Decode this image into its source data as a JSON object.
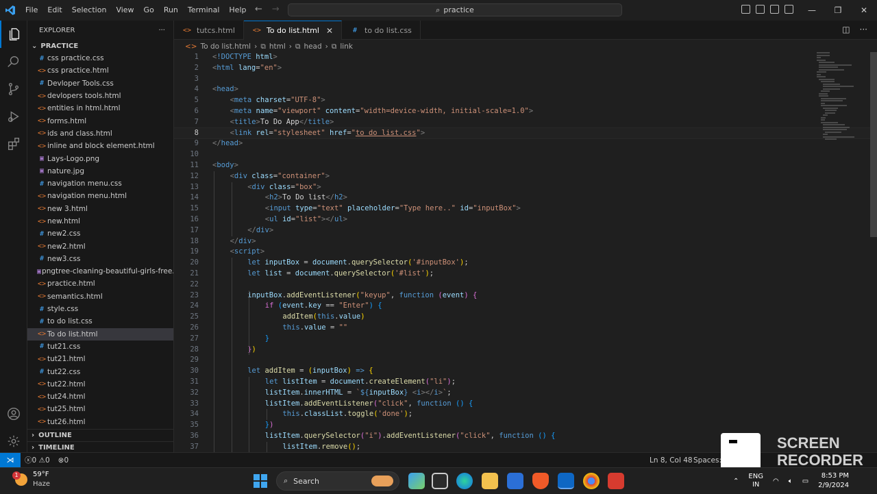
{
  "titlebar": {
    "menu": [
      "File",
      "Edit",
      "Selection",
      "View",
      "Go",
      "Run",
      "Terminal",
      "Help"
    ],
    "search_text": "practice"
  },
  "explorer": {
    "title": "EXPLORER",
    "folder": "PRACTICE",
    "files": [
      {
        "name": "css practice.css",
        "type": "css"
      },
      {
        "name": "css practice.html",
        "type": "html"
      },
      {
        "name": "Devloper Tools.css",
        "type": "css"
      },
      {
        "name": "devlopers tools.html",
        "type": "html"
      },
      {
        "name": "entities in html.html",
        "type": "html"
      },
      {
        "name": "forms.html",
        "type": "html"
      },
      {
        "name": "ids and class.html",
        "type": "html"
      },
      {
        "name": "inline and block element.html",
        "type": "html"
      },
      {
        "name": "Lays-Logo.png",
        "type": "img"
      },
      {
        "name": "nature.jpg",
        "type": "img"
      },
      {
        "name": "navigation menu.css",
        "type": "css"
      },
      {
        "name": "navigation menu.html",
        "type": "html"
      },
      {
        "name": "new 3.html",
        "type": "html"
      },
      {
        "name": "new.html",
        "type": "html"
      },
      {
        "name": "new2.css",
        "type": "css"
      },
      {
        "name": "new2.html",
        "type": "html"
      },
      {
        "name": "new3.css",
        "type": "css"
      },
      {
        "name": "pngtree-cleaning-beautiful-girls-free...",
        "type": "img"
      },
      {
        "name": "practice.html",
        "type": "html"
      },
      {
        "name": "semantics.html",
        "type": "html"
      },
      {
        "name": "style.css",
        "type": "css"
      },
      {
        "name": "to do list.css",
        "type": "css"
      },
      {
        "name": "To do list.html",
        "type": "html",
        "selected": true
      },
      {
        "name": "tut21.css",
        "type": "css"
      },
      {
        "name": "tut21.html",
        "type": "html"
      },
      {
        "name": "tut22.css",
        "type": "css"
      },
      {
        "name": "tut22.html",
        "type": "html"
      },
      {
        "name": "tut24.html",
        "type": "html"
      },
      {
        "name": "tut25.html",
        "type": "html"
      },
      {
        "name": "tut26.html",
        "type": "html"
      }
    ],
    "outline": "OUTLINE",
    "timeline": "TIMELINE"
  },
  "tabs": [
    {
      "label": "tutcs.html",
      "type": "html",
      "active": false
    },
    {
      "label": "To do list.html",
      "type": "html",
      "active": true
    },
    {
      "label": "to do list.css",
      "type": "css",
      "active": false
    }
  ],
  "breadcrumb": [
    "To do list.html",
    "html",
    "head",
    "link"
  ],
  "editor": {
    "current_line": 8,
    "lines": [
      {
        "n": "1",
        "indent": 0,
        "html": "<span class='tg'>&lt;</span><span class='tn'>!DOCTYPE</span> <span class='at'>html</span><span class='tg'>&gt;</span>"
      },
      {
        "n": "2",
        "indent": 0,
        "html": "<span class='tg'>&lt;</span><span class='tn'>html</span> <span class='at'>lang</span>=<span class='sv'>\"en\"</span><span class='tg'>&gt;</span>"
      },
      {
        "n": "3",
        "indent": 0,
        "html": ""
      },
      {
        "n": "4",
        "indent": 0,
        "html": "<span class='tg'>&lt;</span><span class='tn'>head</span><span class='tg'>&gt;</span>"
      },
      {
        "n": "5",
        "indent": 1,
        "html": "<span class='tg'>&lt;</span><span class='tn'>meta</span> <span class='at'>charset</span>=<span class='sv'>\"UTF-8\"</span><span class='tg'>&gt;</span>"
      },
      {
        "n": "6",
        "indent": 1,
        "html": "<span class='tg'>&lt;</span><span class='tn'>meta</span> <span class='at'>name</span>=<span class='sv'>\"viewport\"</span> <span class='at'>content</span>=<span class='sv'>\"width=device-width, initial-scale=1.0\"</span><span class='tg'>&gt;</span>"
      },
      {
        "n": "7",
        "indent": 1,
        "html": "<span class='tg'>&lt;</span><span class='tn'>title</span><span class='tg'>&gt;</span><span class='tx'>To Do App</span><span class='tg'>&lt;/</span><span class='tn'>title</span><span class='tg'>&gt;</span>"
      },
      {
        "n": "8",
        "indent": 1,
        "html": "<span class='tg'>&lt;</span><span class='tn'>link</span> <span class='at'>rel</span>=<span class='sv'>\"stylesheet\"</span> <span class='at'>href</span>=<span class='sv'>\"<u>to do list.css</u>\"</span><span class='tg'>&gt;</span>"
      },
      {
        "n": "9",
        "indent": 0,
        "html": "<span class='tg'>&lt;/</span><span class='tn'>head</span><span class='tg'>&gt;</span>"
      },
      {
        "n": "10",
        "indent": 0,
        "html": ""
      },
      {
        "n": "11",
        "indent": 0,
        "html": "<span class='tg'>&lt;</span><span class='tn'>body</span><span class='tg'>&gt;</span>"
      },
      {
        "n": "12",
        "indent": 1,
        "html": "<span class='tg'>&lt;</span><span class='tn'>div</span> <span class='at'>class</span>=<span class='sv'>\"container\"</span><span class='tg'>&gt;</span>"
      },
      {
        "n": "13",
        "indent": 2,
        "html": "<span class='tg'>&lt;</span><span class='tn'>div</span> <span class='at'>class</span>=<span class='sv'>\"box\"</span><span class='tg'>&gt;</span>"
      },
      {
        "n": "14",
        "indent": 3,
        "html": "<span class='tg'>&lt;</span><span class='tn'>h2</span><span class='tg'>&gt;</span><span class='tx'>To Do list</span><span class='tg'>&lt;/</span><span class='tn'>h2</span><span class='tg'>&gt;</span>"
      },
      {
        "n": "15",
        "indent": 3,
        "html": "<span class='tg'>&lt;</span><span class='tn'>input</span> <span class='at'>type</span>=<span class='sv'>\"text\"</span> <span class='at'>placeholder</span>=<span class='sv'>\"Type here..\"</span> <span class='at'>id</span>=<span class='sv'>\"inputBox\"</span><span class='tg'>&gt;</span>"
      },
      {
        "n": "16",
        "indent": 3,
        "html": "<span class='tg'>&lt;</span><span class='tn'>ul</span> <span class='at'>id</span>=<span class='sv'>\"list\"</span><span class='tg'>&gt;&lt;/</span><span class='tn'>ul</span><span class='tg'>&gt;</span>"
      },
      {
        "n": "17",
        "indent": 2,
        "html": "<span class='tg'>&lt;/</span><span class='tn'>div</span><span class='tg'>&gt;</span>"
      },
      {
        "n": "18",
        "indent": 1,
        "html": "<span class='tg'>&lt;/</span><span class='tn'>div</span><span class='tg'>&gt;</span>"
      },
      {
        "n": "19",
        "indent": 1,
        "html": "<span class='tg'>&lt;</span><span class='tn'>script</span><span class='tg'>&gt;</span>"
      },
      {
        "n": "20",
        "indent": 2,
        "html": "<span class='kw'>let</span> <span class='vr'>inputBox</span> = <span class='vr'>document</span>.<span class='fn'>querySelector</span><span class='pr'>(</span><span class='sv'>'#inputBox'</span><span class='pr'>)</span>;"
      },
      {
        "n": "21",
        "indent": 2,
        "html": "<span class='kw'>let</span> <span class='vr'>list</span> = <span class='vr'>document</span>.<span class='fn'>querySelector</span><span class='pr'>(</span><span class='sv'>'#list'</span><span class='pr'>)</span>;"
      },
      {
        "n": "22",
        "indent": 2,
        "html": ""
      },
      {
        "n": "23",
        "indent": 2,
        "html": "<span class='vr'>inputBox</span>.<span class='fn'>addEventListener</span><span class='pr'>(</span><span class='sv'>\"keyup\"</span>, <span class='kw'>function</span> <span class='pp'>(</span><span class='vr'>event</span><span class='pp'>)</span> <span class='pp'>{</span>"
      },
      {
        "n": "24",
        "indent": 3,
        "html": "<span class='pp'>if</span> <span class='pb'>(</span><span class='vr'>event</span>.<span class='vr'>key</span> == <span class='sv'>\"Enter\"</span><span class='pb'>)</span> <span class='pb'>{</span>"
      },
      {
        "n": "25",
        "indent": 4,
        "html": "<span class='fn'>addItem</span><span class='pr'>(</span><span class='kw'>this</span>.<span class='vr'>value</span><span class='pr'>)</span>"
      },
      {
        "n": "26",
        "indent": 4,
        "html": "<span class='kw'>this</span>.<span class='vr'>value</span> = <span class='sv'>\"\"</span>"
      },
      {
        "n": "27",
        "indent": 3,
        "html": "<span class='pb'>}</span>"
      },
      {
        "n": "28",
        "indent": 2,
        "html": "<span class='pp'>}</span><span class='pr'>)</span>"
      },
      {
        "n": "29",
        "indent": 2,
        "html": ""
      },
      {
        "n": "30",
        "indent": 2,
        "html": "<span class='kw'>let</span> <span class='fn'>addItem</span> = <span class='pr'>(</span><span class='vr'>inputBox</span><span class='pr'>)</span> <span class='kw'>=&gt;</span> <span class='pr'>{</span>"
      },
      {
        "n": "31",
        "indent": 3,
        "html": "<span class='kw'>let</span> <span class='vr'>listItem</span> = <span class='vr'>document</span>.<span class='fn'>createElement</span><span class='pp'>(</span><span class='sv'>\"li\"</span><span class='pp'>)</span>;"
      },
      {
        "n": "32",
        "indent": 3,
        "html": "<span class='vr'>listItem</span>.<span class='vr'>innerHTML</span> = <span class='sv'>`</span><span class='kw'>${</span><span class='vr'>inputBox</span><span class='kw'>}</span> <span class='tg'>&lt;</span><span class='tn'>i</span><span class='tg'>&gt;&lt;/</span><span class='tn'>i</span><span class='tg'>&gt;</span><span class='sv'>`</span>;"
      },
      {
        "n": "33",
        "indent": 3,
        "html": "<span class='vr'>listItem</span>.<span class='fn'>addEventListener</span><span class='pp'>(</span><span class='sv'>\"click\"</span>, <span class='kw'>function</span> <span class='pb'>()</span> <span class='pb'>{</span>"
      },
      {
        "n": "34",
        "indent": 4,
        "html": "<span class='kw'>this</span>.<span class='vr'>classList</span>.<span class='fn'>toggle</span><span class='pr'>(</span><span class='sv'>'done'</span><span class='pr'>)</span>;"
      },
      {
        "n": "35",
        "indent": 3,
        "html": "<span class='pb'>}</span><span class='pp'>)</span>"
      },
      {
        "n": "36",
        "indent": 3,
        "html": "<span class='vr'>listItem</span>.<span class='fn'>querySelector</span><span class='pp'>(</span><span class='sv'>\"i\"</span><span class='pp'>)</span>.<span class='fn'>addEventListener</span><span class='pp'>(</span><span class='sv'>\"click\"</span>, <span class='kw'>function</span> <span class='pb'>()</span> <span class='pb'>{</span>"
      },
      {
        "n": "37",
        "indent": 4,
        "html": "<span class='vr'>listItem</span>.<span class='fn'>remove</span><span class='pr'>()</span>;"
      }
    ]
  },
  "statusbar": {
    "errors": "0",
    "warnings": "0",
    "ports": "0",
    "position": "Ln 8, Col 48",
    "spaces": "Spaces: 4"
  },
  "recorder": {
    "text_line1": "SCREEN",
    "text_line2": "RECORDER"
  },
  "taskbar": {
    "temp": "59°F",
    "condition": "Haze",
    "weather_badge": "1",
    "search_label": "Search",
    "lang_line1": "ENG",
    "lang_line2": "IN",
    "time": "8:53 PM",
    "date": "2/9/2024"
  },
  "colors": {
    "accent": "#0078d4",
    "editor_bg": "#1f1f1f",
    "sidebar_bg": "#181818"
  }
}
